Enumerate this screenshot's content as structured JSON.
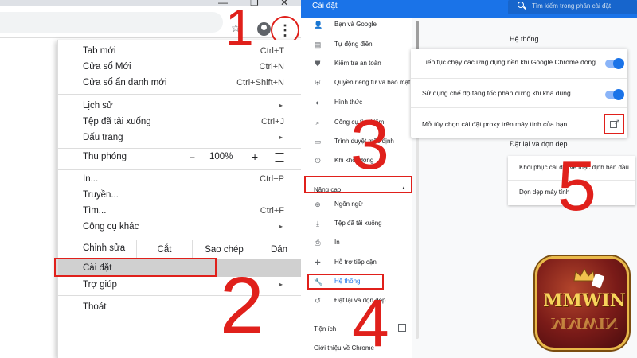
{
  "left": {
    "menu": {
      "items_top": [
        {
          "label": "Tab mới",
          "shortcut": "Ctrl+T"
        },
        {
          "label": "Cửa sổ Mới",
          "shortcut": "Ctrl+N"
        },
        {
          "label": "Cửa sổ ẩn danh mới",
          "shortcut": "Ctrl+Shift+N"
        }
      ],
      "items_history": [
        {
          "label": "Lịch sử",
          "submenu": true
        },
        {
          "label": "Tệp đã tải xuống",
          "shortcut": "Ctrl+J"
        },
        {
          "label": "Dấu trang",
          "submenu": true
        }
      ],
      "zoom": {
        "label": "Thu phóng",
        "minus": "−",
        "value": "100%",
        "plus": "+"
      },
      "items_print": [
        {
          "label": "In...",
          "shortcut": "Ctrl+P"
        },
        {
          "label": "Truyền...",
          "shortcut": ""
        },
        {
          "label": "Tìm...",
          "shortcut": "Ctrl+F"
        },
        {
          "label": "Công cụ khác",
          "submenu": true
        }
      ],
      "edit": {
        "label": "Chỉnh sửa",
        "cut": "Cắt",
        "copy": "Sao chép",
        "paste": "Dán"
      },
      "settings": {
        "label": "Cài đặt"
      },
      "help": {
        "label": "Trợ giúp"
      },
      "exit": {
        "label": "Thoát"
      }
    },
    "icons": {
      "star": "☆",
      "kebab": "⋮",
      "chevron": "▸"
    }
  },
  "right": {
    "header_title": "Cài đặt",
    "search_placeholder": "Tìm kiếm trong phần cài đặt",
    "sidebar": [
      {
        "icon": "👤",
        "label": "Bạn và Google"
      },
      {
        "icon": "▤",
        "label": "Tự động điền"
      },
      {
        "icon": "⛊",
        "label": "Kiểm tra an toàn"
      },
      {
        "icon": "⛨",
        "label": "Quyền riêng tư và bảo mật"
      },
      {
        "icon": "◐",
        "label": "Hình thức"
      },
      {
        "icon": "⌕",
        "label": "Công cụ tìm kiếm"
      },
      {
        "icon": "▭",
        "label": "Trình duyệt mặc định"
      },
      {
        "icon": "⏻",
        "label": "Khi khởi động"
      }
    ],
    "advanced_label": "Nâng cao",
    "advanced_caret": "▲",
    "advanced_items": [
      {
        "icon": "⊕",
        "label": "Ngôn ngữ"
      },
      {
        "icon": "⤓",
        "label": "Tệp đã tải xuống"
      },
      {
        "icon": "⎙",
        "label": "In"
      },
      {
        "icon": "✚",
        "label": "Hỗ trợ tiếp cận"
      },
      {
        "icon": "🔧",
        "label": "Hệ thống",
        "active": true
      },
      {
        "icon": "↺",
        "label": "Đặt lại và dọn dẹp"
      }
    ],
    "extensions_label": "Tiện ích",
    "about_label": "Giới thiệu về Chrome",
    "system_title": "Hệ thống",
    "system_rows": [
      "Tiếp tục chạy các ứng dụng nền khi Google Chrome đóng",
      "Sử dụng chế độ tăng tốc phần cứng khi khả dụng",
      "Mở tùy chọn cài đặt proxy trên máy tính của bạn"
    ],
    "reset_title": "Đặt lại và dọn dẹp",
    "reset_rows": [
      "Khôi phục cài đặt về mặc định ban đầu",
      "Dọn dẹp máy tính"
    ]
  },
  "steps": [
    "1",
    "2",
    "3",
    "4",
    "5"
  ],
  "logo": {
    "line1": "MMWIN",
    "line2": "MMWIN"
  },
  "colors": {
    "accent_red": "#e0201b",
    "chrome_blue": "#1a73e8"
  }
}
